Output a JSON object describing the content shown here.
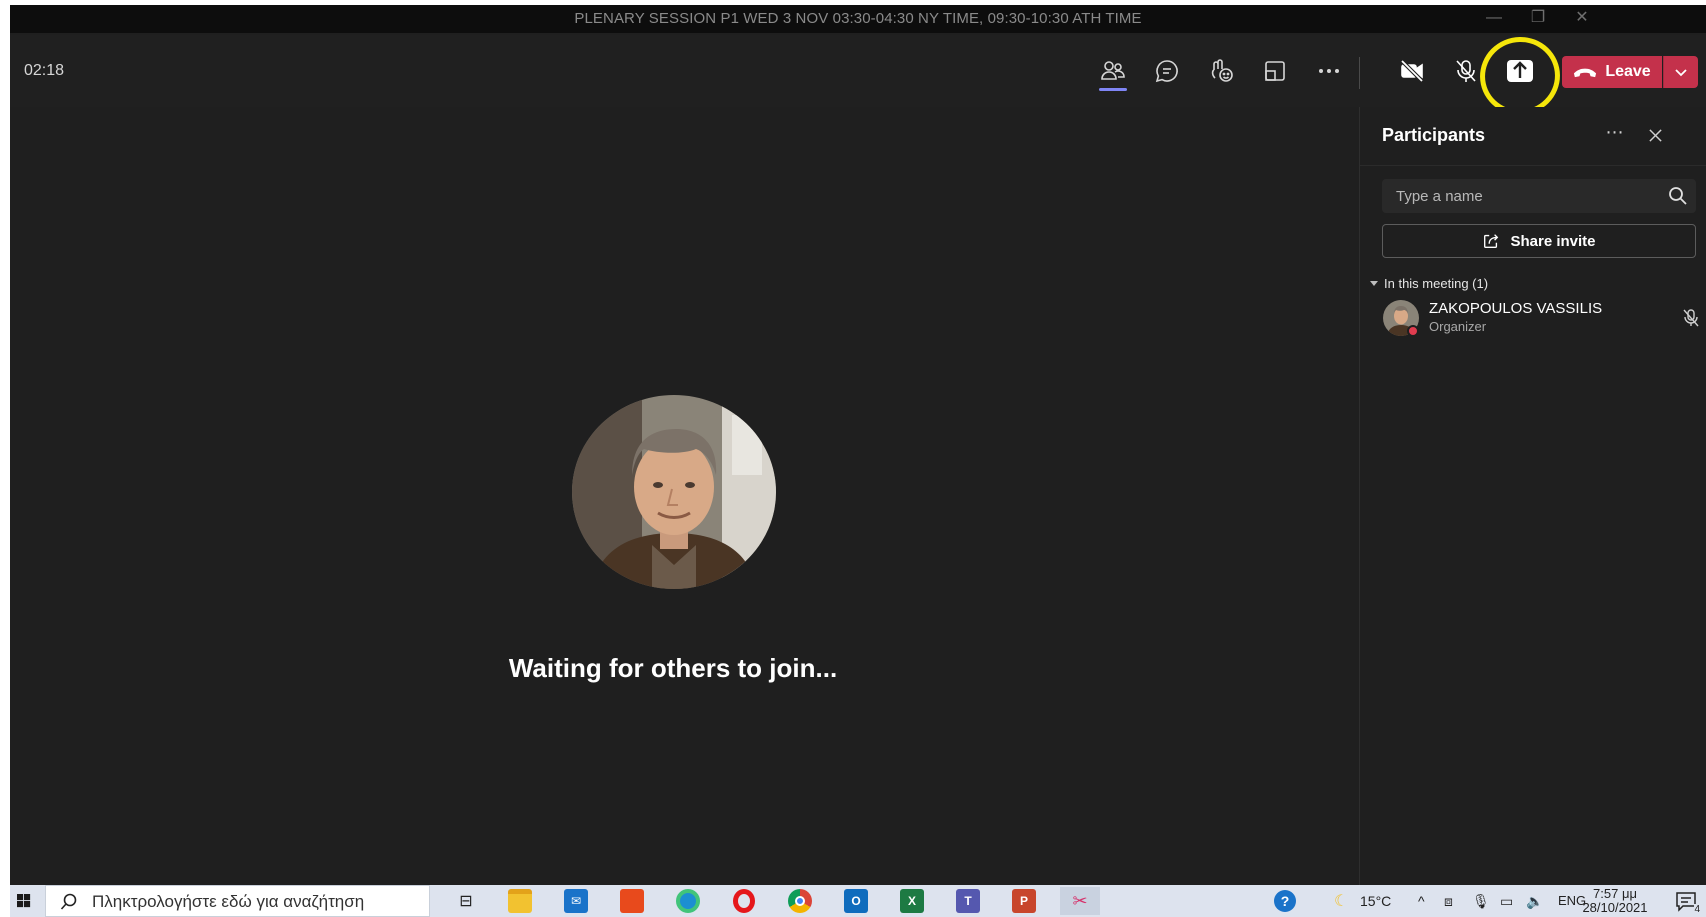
{
  "window": {
    "title": "PLENARY SESSION P1 WED 3 NOV 03:30-04:30 NY TIME, 09:30-10:30 ATH TIME",
    "controls": [
      "minimize-icon",
      "restore-icon",
      "close-icon"
    ]
  },
  "toolbar": {
    "timer": "02:18",
    "buttons": [
      "people-icon",
      "chat-icon",
      "reactions-icon",
      "rooms-icon",
      "more-icon",
      "camera-off-icon",
      "mic-off-icon",
      "share-tray-icon"
    ],
    "leave_label": "Leave",
    "leave_color": "#c4314b",
    "highlight_color": "#f5e60a"
  },
  "stage": {
    "waiting_text": "Waiting for others to join..."
  },
  "participants": {
    "title": "Participants",
    "search_placeholder": "Type a name",
    "share_invite_label": "Share invite",
    "section_label": "In this meeting (1)",
    "people": [
      {
        "name": "ZAKOPOULOS VASSILIS",
        "role": "Organizer",
        "muted": true
      }
    ]
  },
  "taskbar": {
    "search_placeholder": "Πληκτρολογήστε εδώ για αναζήτηση",
    "apps": [
      "task-view-icon",
      "file-explorer-icon",
      "mail-icon",
      "office-icon",
      "edge-icon",
      "opera-icon",
      "chrome-icon",
      "outlook-icon",
      "excel-icon",
      "teams-icon",
      "powerpoint-icon",
      "snip-icon"
    ],
    "weather": "15°C",
    "language": "ENG",
    "time": "7:57 μμ",
    "date": "28/10/2021",
    "notification_count": "4"
  }
}
